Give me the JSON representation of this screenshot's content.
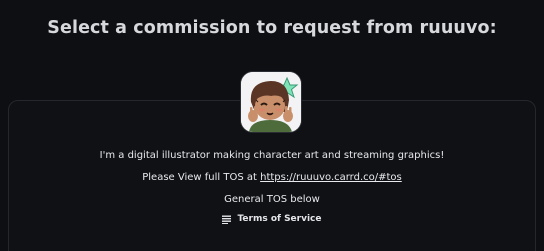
{
  "header": {
    "title": "Select a commission to request from ruuuvo:"
  },
  "profile": {
    "avatar_icon": "artist-avatar"
  },
  "bio": {
    "line1": "I'm a digital illustrator making character art and streaming graphics!",
    "line2_prefix": "Please View full TOS at ",
    "tos_url": "https://ruuuvo.carrd.co/#tos",
    "line3": "General TOS below"
  },
  "terms": {
    "icon": "list-icon",
    "label": "Terms of Service"
  }
}
